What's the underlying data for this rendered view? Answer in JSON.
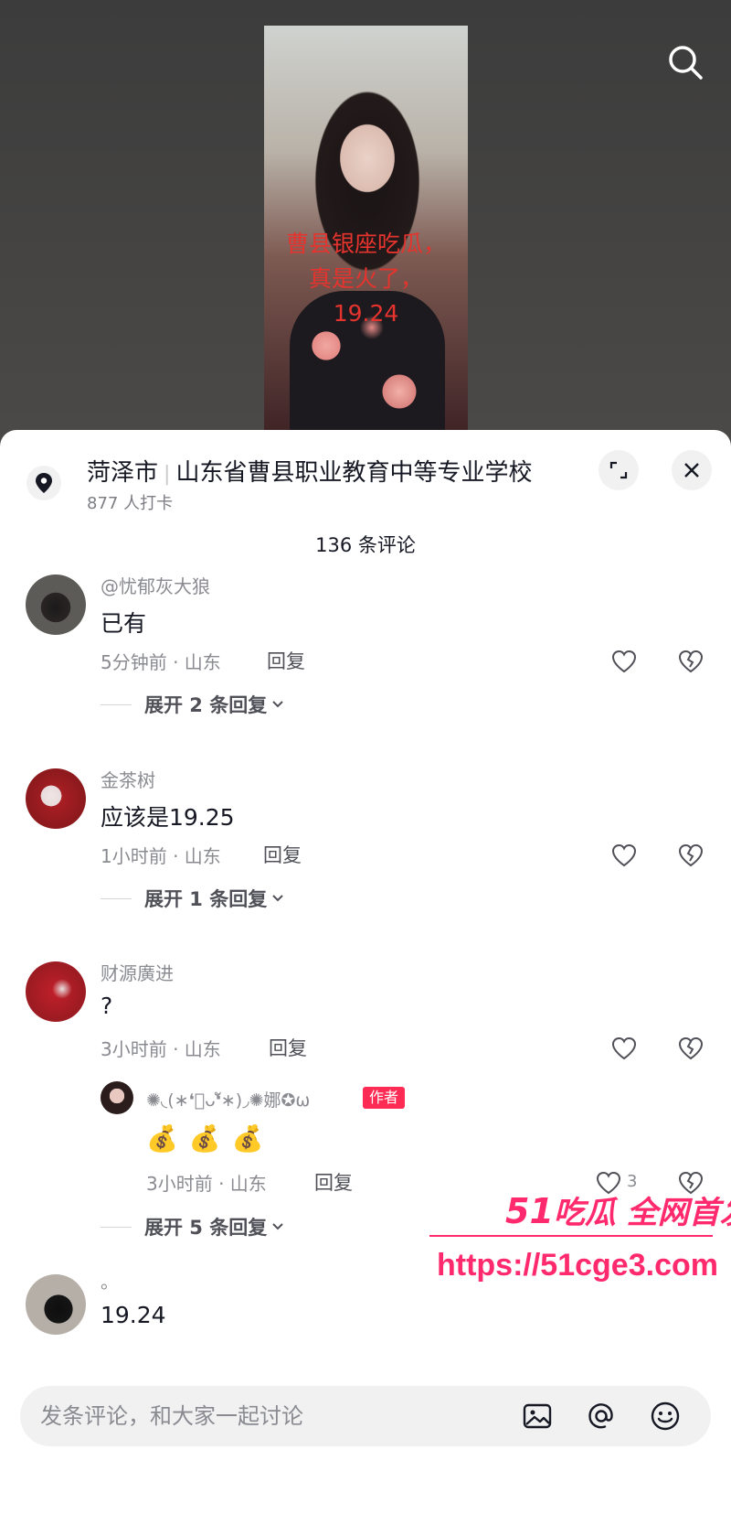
{
  "video": {
    "caption_line1": "曹县银座吃瓜，",
    "caption_line2": "真是火了，",
    "caption_line3": "19.24"
  },
  "location": {
    "city": "菏泽市",
    "place": "山东省曹县职业教育中等专业学校",
    "checkins": "877 人打卡"
  },
  "comment_count": "136 条评论",
  "comments": [
    {
      "name": "@忧郁灰大狼",
      "text": "已有",
      "meta": "5分钟前 · 山东",
      "reply": "回复",
      "expand": "展开 2 条回复"
    },
    {
      "name": "金茶树",
      "text": "应该是19.25",
      "meta": "1小时前 · 山东",
      "reply": "回复",
      "expand": "展开 1 条回复"
    },
    {
      "name": "财源廣进",
      "text": "?",
      "meta": "3小时前 · 山东",
      "reply": "回复",
      "sub": {
        "name": "✺◟(∗❛ัᴗ❛ั∗)◞✺娜✪ω",
        "badge": "作者",
        "emoji": "💰💰💰",
        "meta": "3小时前 · 山东",
        "reply": "回复",
        "likes": "3"
      },
      "expand": "展开 5 条回复"
    },
    {
      "name": "。",
      "text": "19.24"
    }
  ],
  "watermark": {
    "num": "51",
    "text": "吃瓜 全网首发",
    "url": "https://51cge3.com"
  },
  "input": {
    "placeholder": "发条评论，和大家一起讨论"
  },
  "colors": {
    "accent": "#fe2c55",
    "watermark": "#ff2a6d",
    "caption": "#e5332e"
  }
}
